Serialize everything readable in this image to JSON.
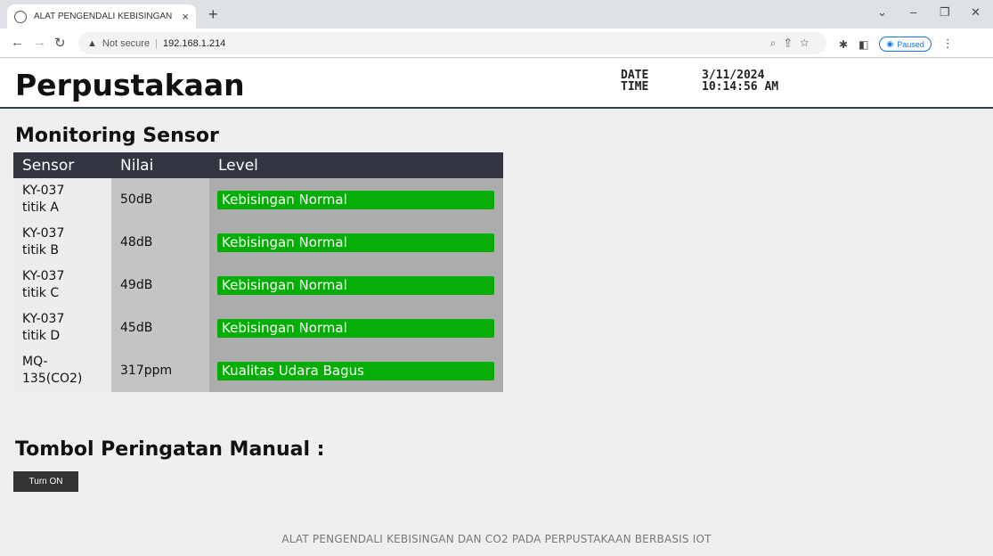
{
  "browser": {
    "tab_title": "ALAT PENGENDALI KEBISINGAN",
    "tab_close": "×",
    "new_tab": "+",
    "security_label": "Not secure",
    "url": "192.168.1.214",
    "paused_label": "Paused",
    "icons": [
      "back-icon",
      "forward-icon",
      "reload-icon",
      "warning-icon",
      "zoom-icon",
      "share-icon",
      "bookmark-star-icon",
      "extensions-icon",
      "side-panel-icon",
      "menu-icon"
    ]
  },
  "header": {
    "title": "Perpustakaan",
    "date_label": "DATE",
    "time_label": "TIME",
    "date_value": "3/11/2024",
    "time_value": "10:14:56 AM"
  },
  "monitoring": {
    "title": "Monitoring Sensor",
    "columns": [
      "Sensor",
      "Nilai",
      "Level"
    ],
    "rows": [
      {
        "sensor_line1": "KY-037",
        "sensor_line2": "titik A",
        "nilai": "50dB",
        "level": "Kebisingan Normal"
      },
      {
        "sensor_line1": "KY-037",
        "sensor_line2": "titik B",
        "nilai": "48dB",
        "level": "Kebisingan Normal"
      },
      {
        "sensor_line1": "KY-037",
        "sensor_line2": "titik C",
        "nilai": "49dB",
        "level": "Kebisingan Normal"
      },
      {
        "sensor_line1": "KY-037",
        "sensor_line2": "titik D",
        "nilai": "45dB",
        "level": "Kebisingan Normal"
      },
      {
        "sensor_line1": "MQ-",
        "sensor_line2": "135(CO2)",
        "nilai": "317ppm",
        "level": "Kualitas Udara Bagus"
      }
    ]
  },
  "manual": {
    "title": "Tombol Peringatan Manual :",
    "button_label": "Turn ON"
  },
  "footer": "ALAT PENGENDALI KEBISINGAN DAN CO2 PADA PERPUSTAKAAN BERBASIS IOT",
  "colors": {
    "level_ok": "#06ad06",
    "table_header": "#333640",
    "header_border": "#333c4f"
  }
}
